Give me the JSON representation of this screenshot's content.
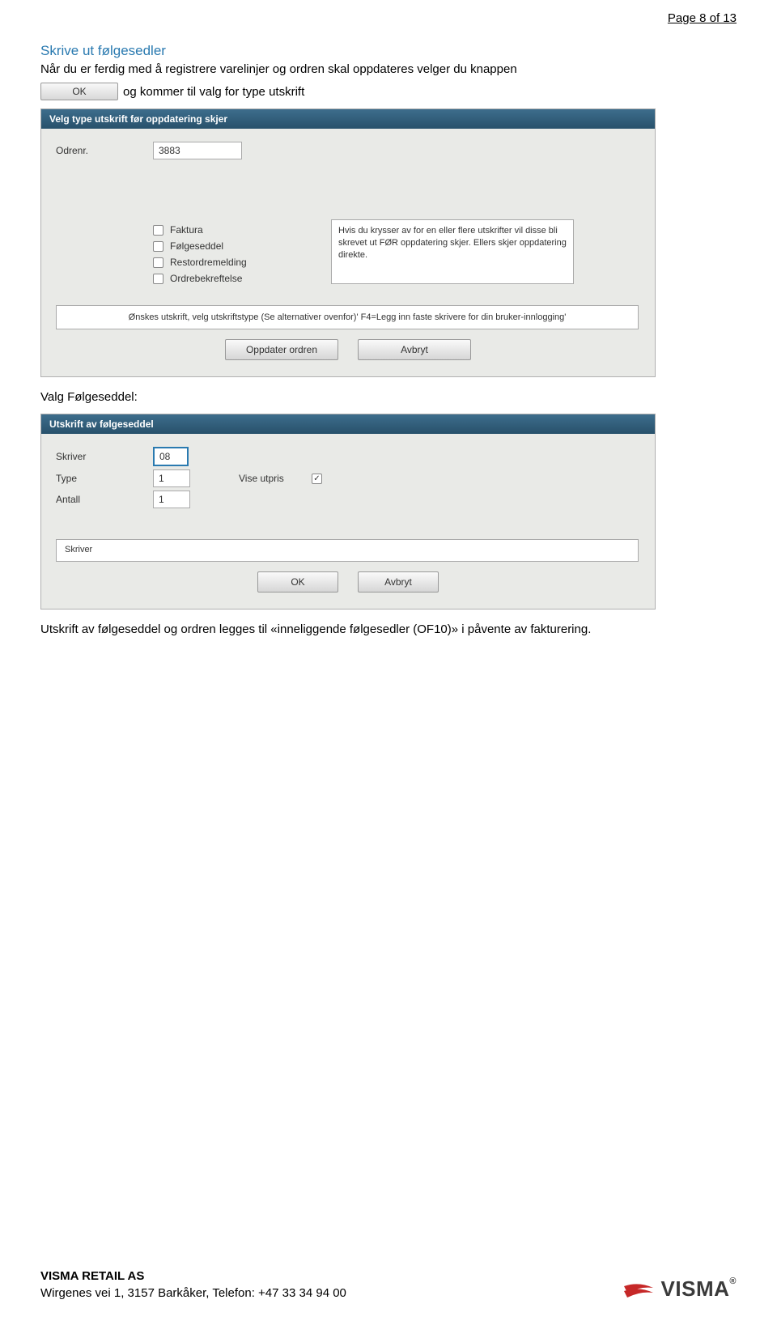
{
  "page": {
    "number_text": "Page 8 of 13"
  },
  "section": {
    "title": "Skrive ut følgesedler",
    "p1": "Når du er ferdig med å registrere varelinjer og ordren skal oppdateres velger du knappen",
    "okbtn": "OK",
    "p2": " og kommer til valg for type utskrift"
  },
  "panel1": {
    "title": "Velg type utskrift før oppdatering skjer",
    "ordenr_label": "Odrenr.",
    "ordenr_value": "3883",
    "checkboxes": {
      "faktura": "Faktura",
      "folgeseddel": "Følgeseddel",
      "restordremelding": "Restordremelding",
      "ordrebekreftelse": "Ordrebekreftelse"
    },
    "info_text": "Hvis du krysser av for en eller flere utskrifter vil disse bli skrevet ut FØR oppdatering skjer. Ellers skjer oppdatering direkte.",
    "hint_text": "Ønskes utskrift, velg utskriftstype (Se alternativer ovenfor)' F4=Legg inn faste skrivere for din bruker-innlogging'",
    "btn_oppdater": "Oppdater ordren",
    "btn_avbryt": "Avbryt"
  },
  "mid_text": "Valg Følgeseddel:",
  "panel2": {
    "title": "Utskrift av følgeseddel",
    "skriver_label": "Skriver",
    "skriver_value": "08",
    "type_label": "Type",
    "type_value": "1",
    "vise_utpris_label": "Vise utpris",
    "antall_label": "Antall",
    "antall_value": "1",
    "skriver_box": "Skriver",
    "btn_ok": "OK",
    "btn_avbryt": "Avbryt"
  },
  "bottom_text": "Utskrift av følgeseddel og ordren legges til «inneliggende følgesedler (OF10)» i påvente av fakturering.",
  "footer": {
    "company": "VISMA RETAIL AS",
    "address": "Wirgenes vei 1, 3157 Barkåker, Telefon: +47 33 34 94 00",
    "logo_text": "VISMA"
  }
}
